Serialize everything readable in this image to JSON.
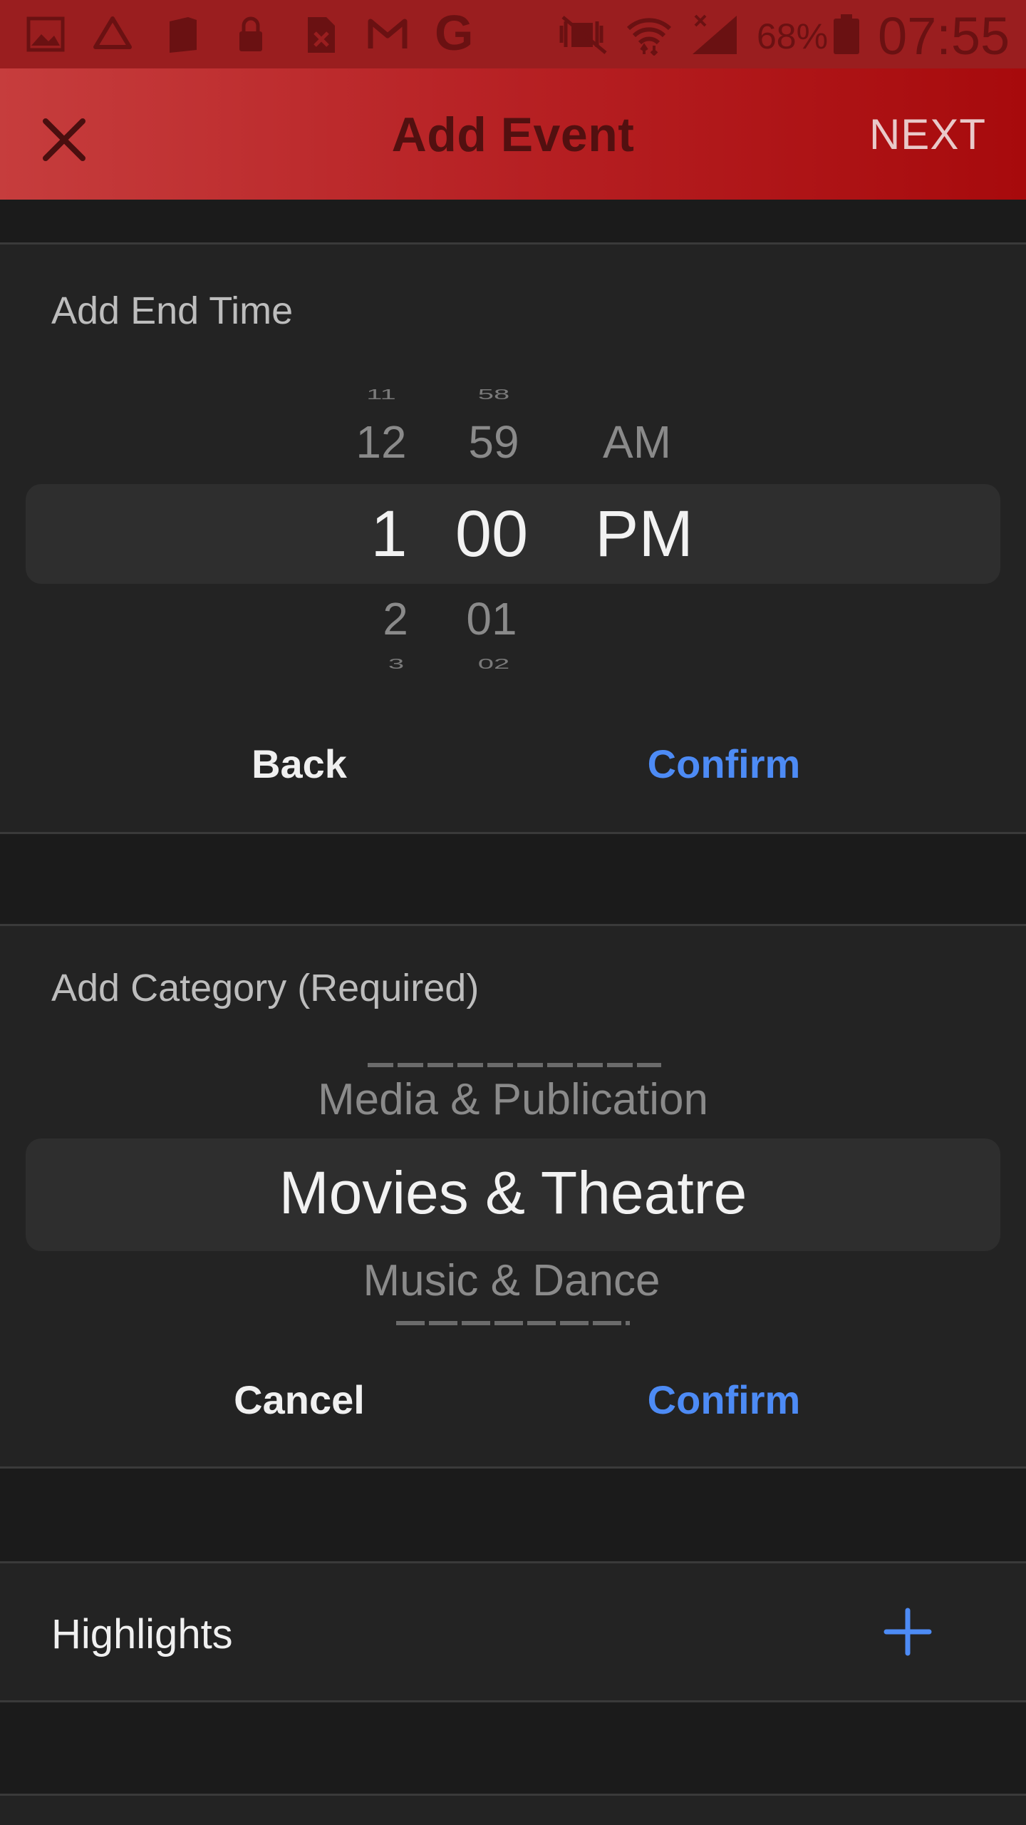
{
  "status_bar": {
    "battery": "68%",
    "time": "07:55",
    "icons": [
      "gallery-icon",
      "drive-icon",
      "sim-icon",
      "lock-icon",
      "file-x-icon",
      "gmail-icon",
      "google-icon",
      "mute-icon",
      "wifi-icon",
      "signal-icon",
      "battery-icon"
    ]
  },
  "app_bar": {
    "title": "Add Event",
    "next_label": "NEXT",
    "close_icon": "close-icon"
  },
  "end_time": {
    "label": "Add End Time",
    "hours": [
      "11",
      "12",
      "1",
      "2",
      "3"
    ],
    "minutes": [
      "58",
      "59",
      "00",
      "01",
      "02"
    ],
    "periods": [
      "AM",
      "PM"
    ],
    "selected": {
      "hour": "1",
      "minute": "00",
      "period": "PM"
    },
    "back_label": "Back",
    "confirm_label": "Confirm"
  },
  "category": {
    "label": "Add Category (Required)",
    "options_above": [
      "Media & Publication"
    ],
    "selected": "Movies & Theatre",
    "options_below": [
      "Music & Dance"
    ],
    "cancel_label": "Cancel",
    "confirm_label": "Confirm"
  },
  "highlights": {
    "label": "Highlights",
    "add_icon": "plus-icon"
  },
  "colors": {
    "accent_blue": "#4d8bf5",
    "app_bar_red": "#b82326",
    "background": "#1b1b1b"
  }
}
